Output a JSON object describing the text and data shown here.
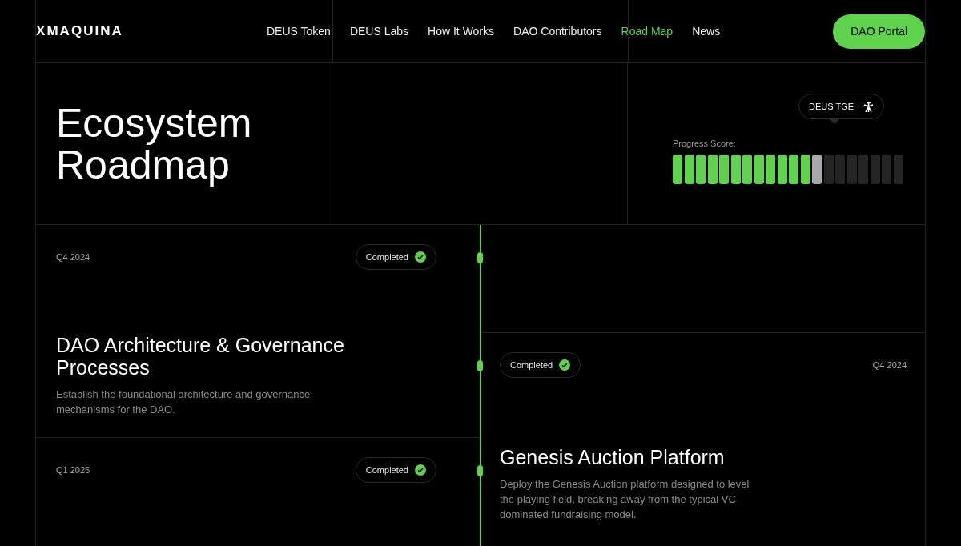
{
  "header": {
    "logo": "XMAQUINA",
    "nav": [
      {
        "label": "DEUS Token",
        "selected": false
      },
      {
        "label": "DEUS Labs",
        "selected": false
      },
      {
        "label": "How It Works",
        "selected": false
      },
      {
        "label": "DAO Contributors",
        "selected": false
      },
      {
        "label": "Road Map",
        "selected": true
      },
      {
        "label": "News",
        "selected": false
      }
    ],
    "cta": "DAO Portal"
  },
  "hero": {
    "title": "Ecosystem Roadmap",
    "progress_label": "Progress Score:",
    "tooltip": "DEUS TGE",
    "segments": [
      {
        "kind": "done"
      },
      {
        "kind": "done"
      },
      {
        "kind": "done"
      },
      {
        "kind": "done"
      },
      {
        "kind": "done"
      },
      {
        "kind": "done"
      },
      {
        "kind": "done"
      },
      {
        "kind": "done"
      },
      {
        "kind": "done"
      },
      {
        "kind": "done"
      },
      {
        "kind": "done"
      },
      {
        "kind": "done"
      },
      {
        "kind": "current"
      },
      {
        "kind": "pending"
      },
      {
        "kind": "pending"
      },
      {
        "kind": "pending"
      },
      {
        "kind": "pending"
      },
      {
        "kind": "pending"
      },
      {
        "kind": "pending"
      },
      {
        "kind": "pending"
      }
    ]
  },
  "timeline": {
    "left": [
      {
        "quarter": "Q4 2024",
        "status": "Completed",
        "completed": true,
        "title": "DAO Architecture & Governance Processes",
        "description": "Establish the foundational architecture and governance mechanisms for the DAO."
      },
      {
        "quarter": "Q1 2025",
        "status": "Completed",
        "completed": true
      }
    ],
    "right": [
      {
        "quarter": "Q4 2024",
        "status": "Completed",
        "completed": true,
        "title": "Genesis Auction Platform",
        "description": "Deploy the Genesis Auction platform designed to level the playing field, breaking away from the typical VC-dominated fundraising model."
      }
    ]
  }
}
